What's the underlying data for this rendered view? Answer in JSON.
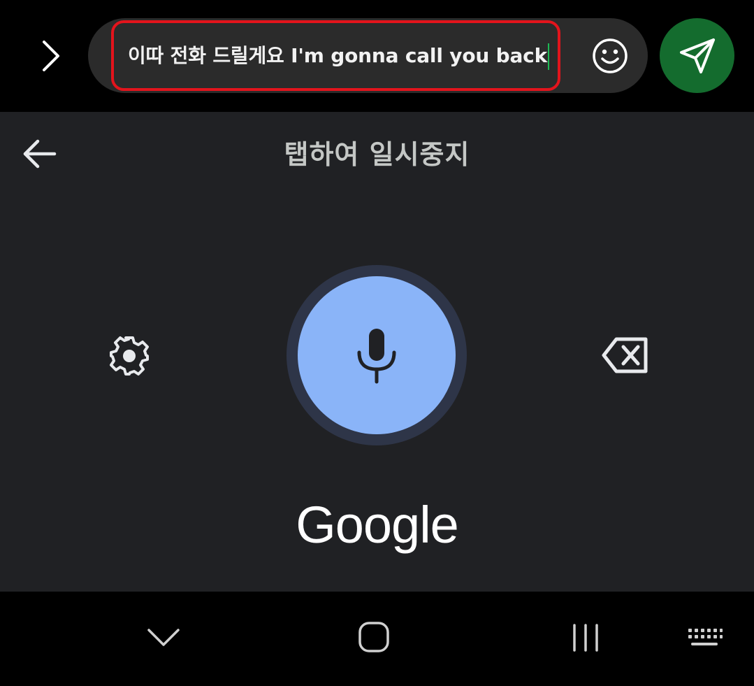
{
  "compose": {
    "message_text": "이따 전화 드릴게요 I'm gonna call you back",
    "expand_icon": "chevron-right-icon",
    "emoji_icon": "smiley-icon",
    "send_icon": "send-icon",
    "send_color": "#146c2e",
    "highlight_color": "#e3141c"
  },
  "voice_input": {
    "status": "탭하여 일시중지",
    "back_icon": "arrow-left-icon",
    "settings_icon": "gear-icon",
    "mic_icon": "microphone-icon",
    "delete_icon": "backspace-icon",
    "brand": "Google",
    "mic_color": "#8ab4f8"
  },
  "navbar": {
    "items": [
      "hide-keyboard",
      "home",
      "recent-apps",
      "keyboard-switcher"
    ]
  }
}
